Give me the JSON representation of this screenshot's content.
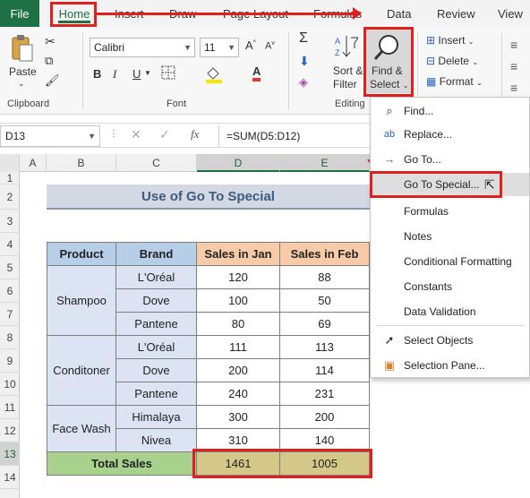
{
  "tabs": [
    "File",
    "Home",
    "Insert",
    "Draw",
    "Page Layout",
    "Formulas",
    "Data",
    "Review",
    "View"
  ],
  "ribbon": {
    "clipboard": {
      "label": "Clipboard",
      "paste": "Paste"
    },
    "font": {
      "label": "Font",
      "name": "Calibri",
      "size": "11",
      "bold": "B",
      "italic": "I",
      "underline": "U"
    },
    "editing": {
      "label": "Editing",
      "sort_filter_1": "Sort &",
      "sort_filter_2": "Filter",
      "find_select_1": "Find &",
      "find_select_2": "Select"
    },
    "cells": {
      "insert": "Insert",
      "delete": "Delete",
      "format": "Format"
    }
  },
  "formula_bar": {
    "name_box": "D13",
    "cancel": "✕",
    "enter": "✓",
    "fx": "fx",
    "formula": "=SUM(D5:D12)"
  },
  "columns": [
    "A",
    "B",
    "C",
    "D",
    "E"
  ],
  "rows": [
    "1",
    "2",
    "3",
    "4",
    "5",
    "6",
    "7",
    "8",
    "9",
    "10",
    "11",
    "12",
    "13",
    "14"
  ],
  "sheet": {
    "title": "Use of Go To Special",
    "headers": [
      "Product",
      "Brand",
      "Sales in Jan",
      "Sales in Feb"
    ],
    "groups": [
      {
        "product": "Shampoo",
        "rows": [
          [
            "L'Oréal",
            "120",
            "88"
          ],
          [
            "Dove",
            "100",
            "50"
          ],
          [
            "Pantene",
            "80",
            "69"
          ]
        ]
      },
      {
        "product": "Conditoner",
        "rows": [
          [
            "L'Oréal",
            "111",
            "113"
          ],
          [
            "Dove",
            "200",
            "114"
          ],
          [
            "Pantene",
            "240",
            "231"
          ]
        ]
      },
      {
        "product": "Face Wash",
        "rows": [
          [
            "Himalaya",
            "300",
            "200"
          ],
          [
            "Nivea",
            "310",
            "140"
          ]
        ]
      }
    ],
    "total_label": "Total Sales",
    "total_jan": "1461",
    "total_feb": "1005"
  },
  "menu": {
    "items": [
      {
        "label": "Find...",
        "icon": "search-icon"
      },
      {
        "label": "Replace...",
        "icon": "replace-icon"
      },
      {
        "label": "Go To...",
        "icon": "arrow-right-icon"
      },
      {
        "label": "Go To Special...",
        "icon": ""
      },
      {
        "label": "Formulas",
        "icon": ""
      },
      {
        "label": "Notes",
        "icon": ""
      },
      {
        "label": "Conditional Formatting",
        "icon": ""
      },
      {
        "label": "Constants",
        "icon": ""
      },
      {
        "label": "Data Validation",
        "icon": ""
      },
      {
        "label": "Select Objects",
        "icon": "cursor-icon"
      },
      {
        "label": "Selection Pane...",
        "icon": "selection-pane-icon"
      }
    ]
  },
  "colors": {
    "accent": "#1e7145",
    "highlight": "#e0201e"
  }
}
